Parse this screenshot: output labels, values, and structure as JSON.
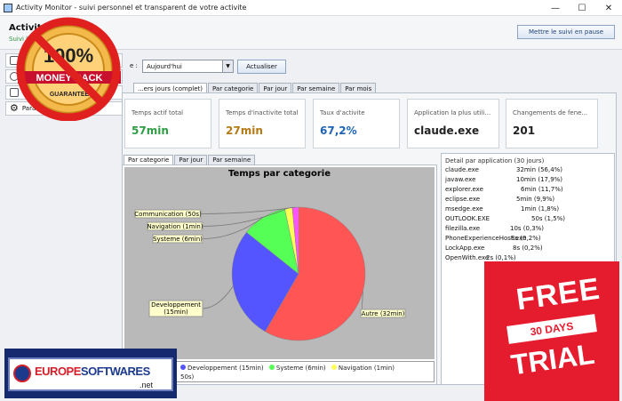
{
  "window": {
    "title": "Activity Monitor - suivi personnel et transparent de votre activite",
    "minimize": "—",
    "maximize": "☐",
    "close": "✕"
  },
  "header": {
    "title": "Activity Monitor",
    "subtitle": "Suivi local — ment uniquement",
    "pause_button": "Mettre le suivi en pause"
  },
  "sidebar": {
    "items": [
      {
        "label": "",
        "icon": "window-icon"
      },
      {
        "label": "",
        "icon": "clock-icon"
      },
      {
        "label": "",
        "icon": "folder-icon"
      },
      {
        "label": "Param",
        "icon": "gear-icon"
      }
    ]
  },
  "period": {
    "label": "e :",
    "selected": "Aujourd'hui",
    "update_button": "Actualiser"
  },
  "tabs": [
    "...ers jours (complet)",
    "Par categorie",
    "Par jour",
    "Par semaine",
    "Par mois"
  ],
  "stats": [
    {
      "label": "Temps actif total",
      "value": "57min",
      "color": "#2e9e45"
    },
    {
      "label": "Temps d'inactivite total",
      "value": "27min",
      "color": "#b37a14"
    },
    {
      "label": "Taux d'activite",
      "value": "67,2%",
      "color": "#1e63b4"
    },
    {
      "label": "Application la plus utili...",
      "value": "claude.exe",
      "color": "#222222"
    },
    {
      "label": "Changements de fene...",
      "value": "201",
      "color": "#222222"
    }
  ],
  "chart_tabs": [
    "Par categorie",
    "Par jour",
    "Par semaine"
  ],
  "chart_data": {
    "type": "pie",
    "title": "Temps par categorie",
    "slices": [
      {
        "name": "Autre",
        "label": "Autre (32min)",
        "value": 32,
        "color": "#ff5555"
      },
      {
        "name": "Developpement",
        "label": "Developpement (15min)",
        "value": 15,
        "color": "#5555ff"
      },
      {
        "name": "Systeme",
        "label": "Systeme (6min)",
        "value": 6,
        "color": "#55ff55"
      },
      {
        "name": "Navigation",
        "label": "Navigation (1min)",
        "value": 1,
        "color": "#ffff55"
      },
      {
        "name": "Communication",
        "label": "Communication (50s)",
        "value": 0.83,
        "color": "#ff55ff"
      }
    ],
    "legend": "top-left"
  },
  "legend": {
    "line1_items": [
      {
        "text": "Developpement (15min)",
        "color": "#5555ff"
      },
      {
        "text": "Systeme (6min)",
        "color": "#55ff55"
      },
      {
        "text": "Navigation (1min)",
        "color": "#ffff55"
      }
    ],
    "line2": "50s)"
  },
  "detail": {
    "title": "Detail par application (30 jours)",
    "rows": [
      {
        "name": "claude.exe",
        "value": "32min (56,4%)"
      },
      {
        "name": "javaw.exe",
        "value": "10min (17,9%)"
      },
      {
        "name": "explorer.exe",
        "value": "6min (11,7%)"
      },
      {
        "name": "eclipse.exe",
        "value": "5min (9,9%)"
      },
      {
        "name": "msedge.exe",
        "value": "1min (1,8%)"
      },
      {
        "name": "OUTLOOK.EXE",
        "value": "50s (1,5%)"
      },
      {
        "name": "filezilla.exe",
        "value": "10s (0,3%)"
      },
      {
        "name": "PhoneExperienceHost.exe",
        "value": "8s (0,2%)"
      },
      {
        "name": "LockApp.exe",
        "value": "8s (0,2%)"
      },
      {
        "name": "OpenWith.exe",
        "value": "2s (0,1%)"
      }
    ]
  },
  "promo": {
    "mbg_top": "100%",
    "mbg_middle": "MONEY BACK",
    "mbg_bottom": "GUARANTEE",
    "free": "FREE",
    "days": "30 DAYS",
    "trial": "TRIAL",
    "eu_a": "EUROPE",
    "eu_b": "SOFTWARES",
    "eu_net": ".net"
  }
}
